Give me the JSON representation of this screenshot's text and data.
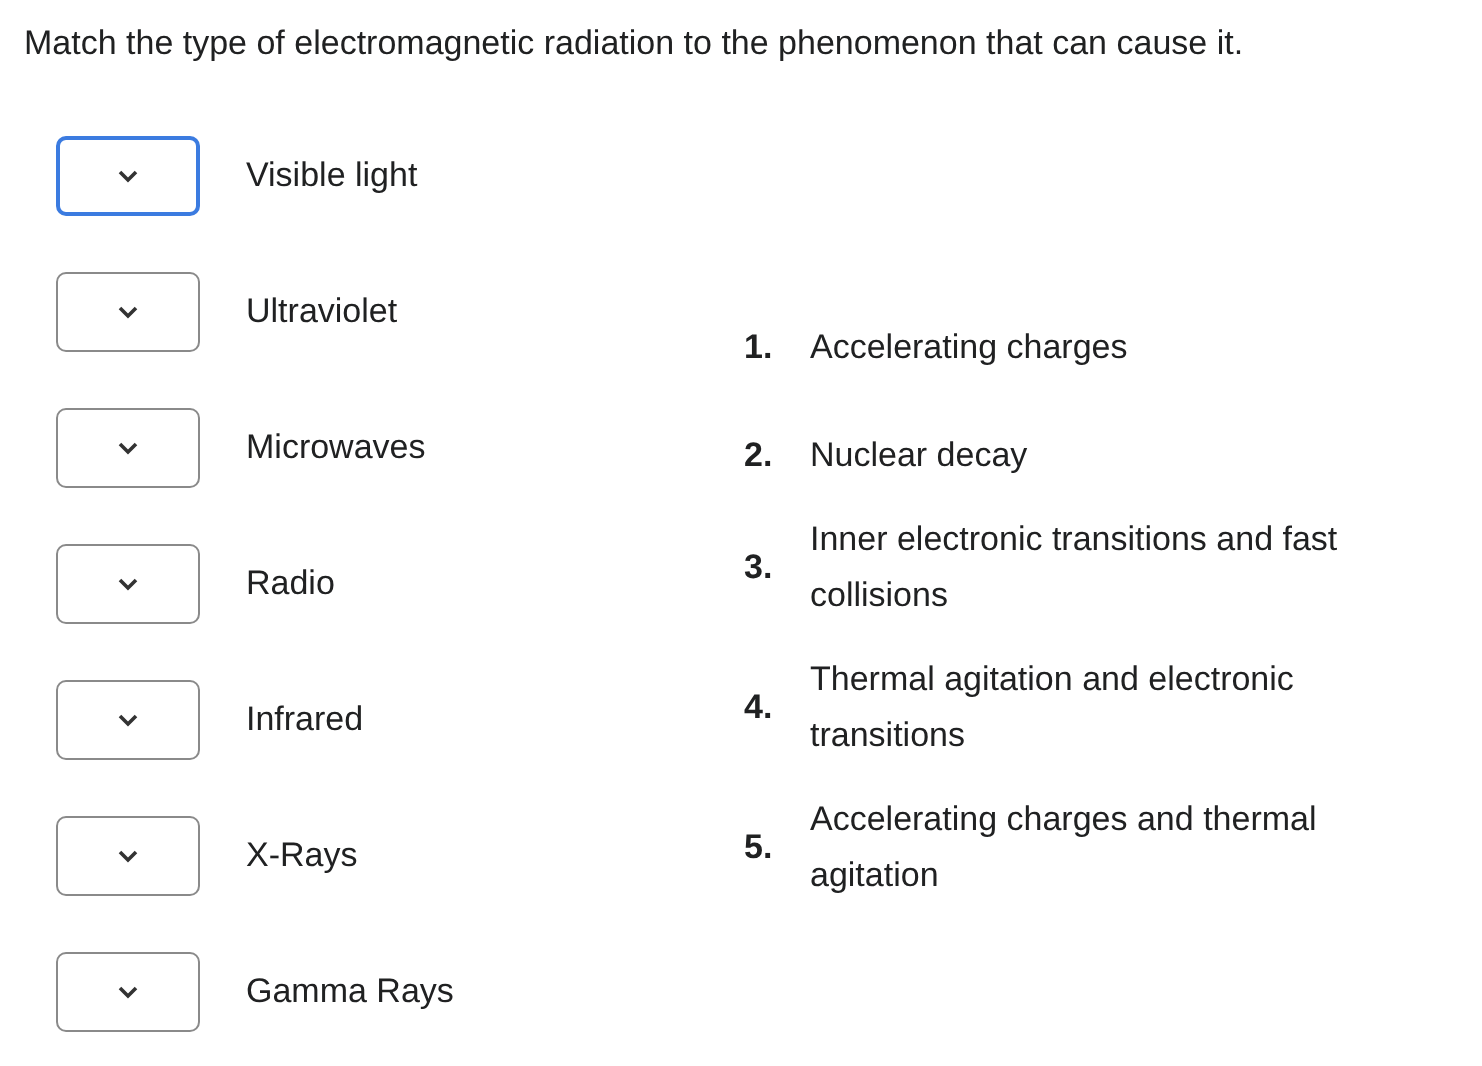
{
  "question": "Match the type of electromagnetic radiation to the phenomenon that can cause it.",
  "items": [
    {
      "label": "Visible light",
      "focused": true
    },
    {
      "label": "Ultraviolet",
      "focused": false
    },
    {
      "label": "Microwaves",
      "focused": false
    },
    {
      "label": "Radio",
      "focused": false
    },
    {
      "label": "Infrared",
      "focused": false
    },
    {
      "label": "X-Rays",
      "focused": false
    },
    {
      "label": "Gamma Rays",
      "focused": false
    }
  ],
  "choices": [
    {
      "number": "1.",
      "text": "Accelerating charges"
    },
    {
      "number": "2.",
      "text": "Nuclear decay"
    },
    {
      "number": "3.",
      "text": "Inner electronic transitions and fast collisions"
    },
    {
      "number": "4.",
      "text": "Thermal agitation and electronic transitions"
    },
    {
      "number": "5.",
      "text": "Accelerating charges and thermal agitation"
    }
  ]
}
